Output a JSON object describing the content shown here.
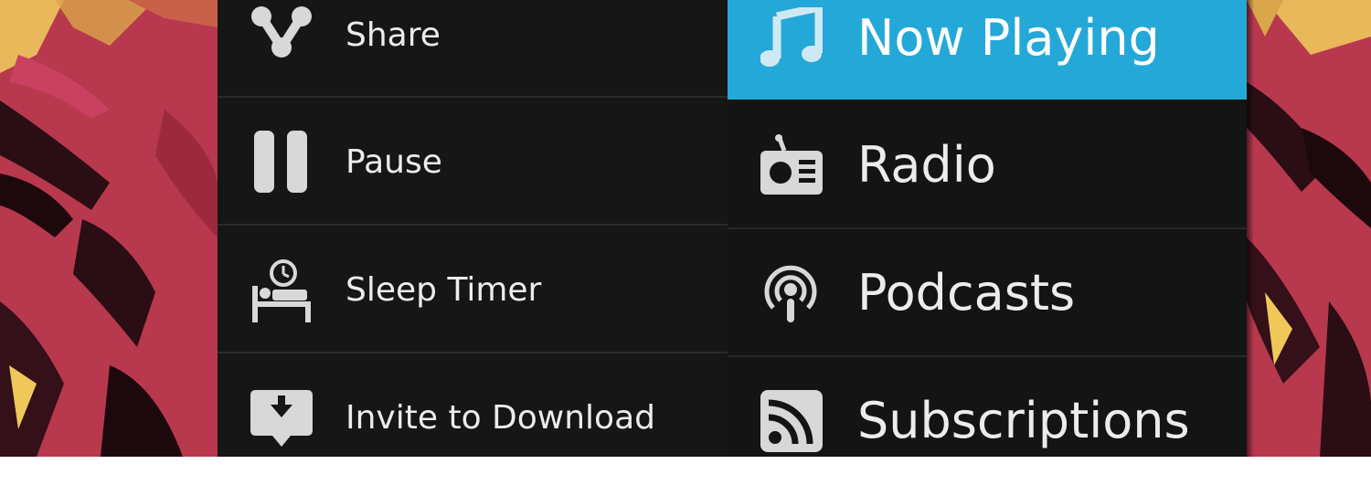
{
  "background": {
    "colors": {
      "base": "#b8384e",
      "dark": "#2a0e14",
      "highlight": "#f0c85a"
    }
  },
  "action_menu": {
    "items": [
      {
        "label": "Share",
        "icon": "share-icon"
      },
      {
        "label": "Pause",
        "icon": "pause-icon"
      },
      {
        "label": "Sleep Timer",
        "icon": "sleep-timer-icon"
      },
      {
        "label": "Invite to Download",
        "icon": "invite-download-icon"
      }
    ]
  },
  "nav_menu": {
    "accent": "#24a8d8",
    "items": [
      {
        "label": "Now Playing",
        "icon": "music-note-icon",
        "selected": true
      },
      {
        "label": "Radio",
        "icon": "radio-icon",
        "selected": false
      },
      {
        "label": "Podcasts",
        "icon": "podcast-icon",
        "selected": false
      },
      {
        "label": "Subscriptions",
        "icon": "rss-icon",
        "selected": false
      }
    ]
  }
}
